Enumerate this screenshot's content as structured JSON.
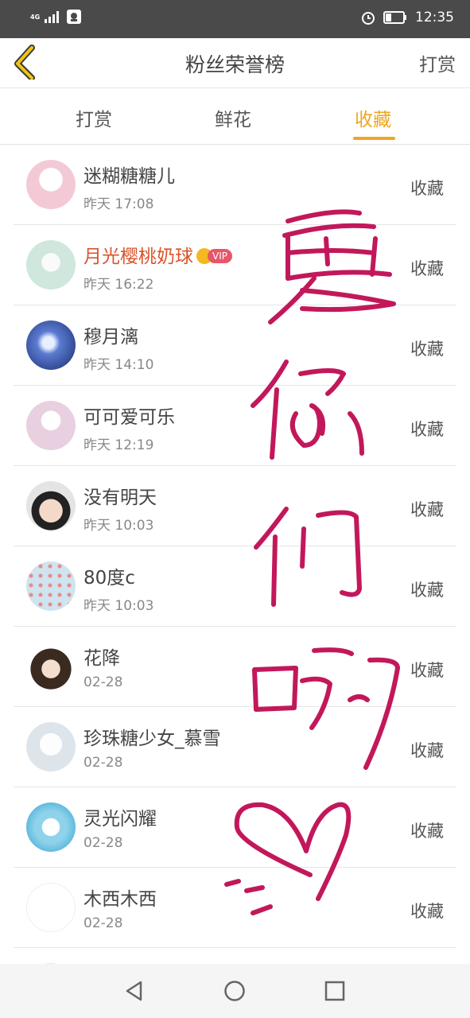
{
  "status_bar": {
    "network": "4G",
    "time": "12:35",
    "icons": [
      "signal-icon",
      "app-notification-icon",
      "alarm-icon",
      "battery-icon"
    ]
  },
  "header": {
    "back_icon": "chevron-left-icon",
    "title": "粉丝荣誉榜",
    "right_label": "打赏"
  },
  "tabs": [
    {
      "label": "打赏",
      "active": false
    },
    {
      "label": "鲜花",
      "active": false
    },
    {
      "label": "收藏",
      "active": true
    }
  ],
  "colors": {
    "accent": "#f0a522",
    "vip_name": "#d9542b",
    "handwriting": "#c2185b"
  },
  "handwritten_overlay_text": "爱你们哟",
  "fans": [
    {
      "name": "迷糊糖糖儿",
      "time": "昨天 17:08",
      "action": "收藏",
      "avatar": "#f4c9d6"
    },
    {
      "name": "月光樱桃奶球",
      "time": "昨天 16:22",
      "action": "收藏",
      "avatar": "#cfe7dc",
      "vip": true,
      "vip_label": "VIP"
    },
    {
      "name": "穆月漓",
      "time": "昨天 14:10",
      "action": "收藏",
      "avatar": "#2d3f8a"
    },
    {
      "name": "可可爱可乐",
      "time": "昨天 12:19",
      "action": "收藏",
      "avatar": "#e8d0e0"
    },
    {
      "name": "没有明天",
      "time": "昨天 10:03",
      "action": "收藏",
      "avatar": "#c9c9c9"
    },
    {
      "name": "80度c",
      "time": "昨天 10:03",
      "action": "收藏",
      "avatar": "#bcd9e6"
    },
    {
      "name": "花降",
      "time": "02-28",
      "action": "收藏",
      "avatar": "#d9b99a"
    },
    {
      "name": "珍珠糖少女_慕雪",
      "time": "02-28",
      "action": "收藏",
      "avatar": "#dde4ea"
    },
    {
      "name": "灵光闪耀",
      "time": "02-28",
      "action": "收藏",
      "avatar": "#59b7d8"
    },
    {
      "name": "木西木西",
      "time": "02-28",
      "action": "收藏",
      "avatar": "#ffffff"
    }
  ],
  "nav_bar": [
    "back-triangle-icon",
    "home-circle-icon",
    "recents-square-icon"
  ]
}
